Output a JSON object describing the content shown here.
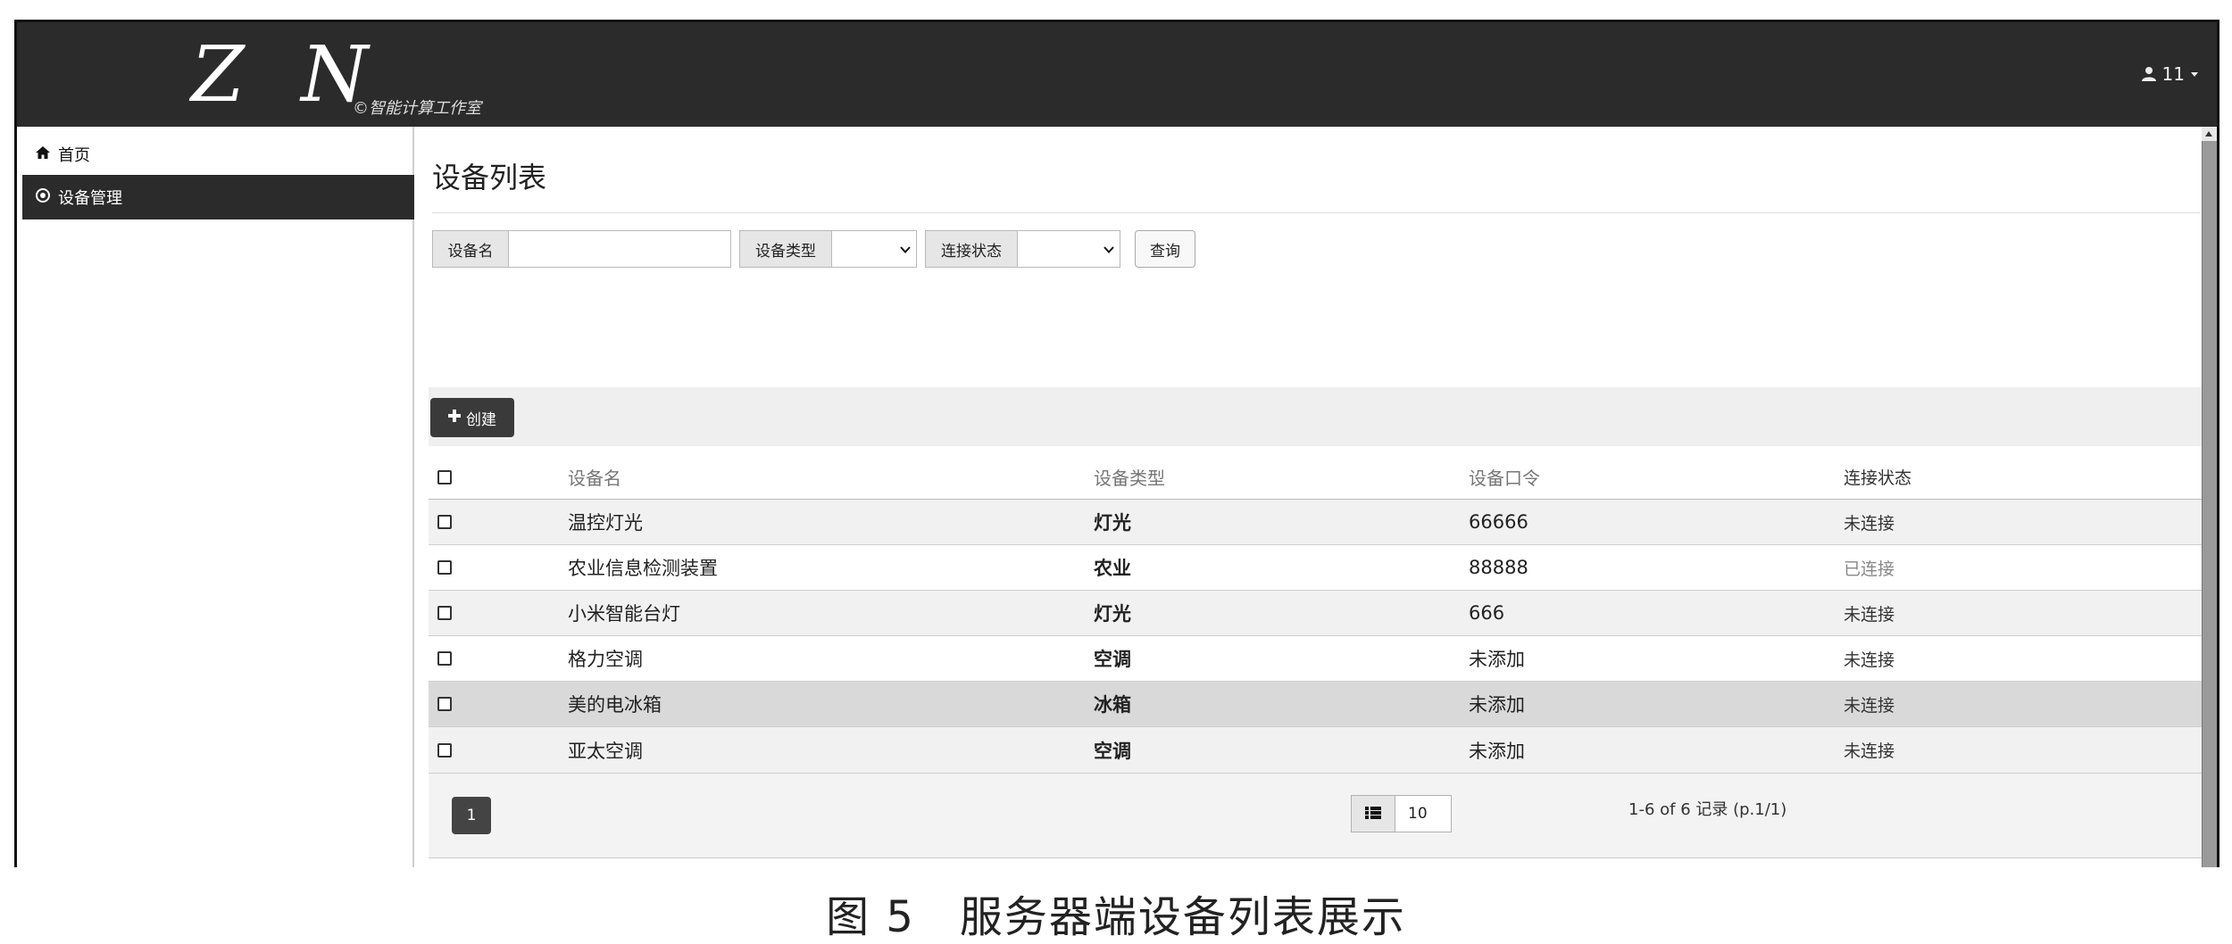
{
  "brand": {
    "logo": "Z N",
    "copyright": "©智能计算工作室"
  },
  "user": {
    "name": "11"
  },
  "sidebar": {
    "items": [
      {
        "label": "首页",
        "icon": "home-icon",
        "active": false
      },
      {
        "label": "设备管理",
        "icon": "circle-icon",
        "active": true
      }
    ]
  },
  "page": {
    "title": "设备列表"
  },
  "filters": {
    "name_label": "设备名",
    "name_value": "",
    "type_label": "设备类型",
    "type_selected": "",
    "status_label": "连接状态",
    "status_selected": "",
    "query_label": "查询"
  },
  "toolbar": {
    "create_label": "创建"
  },
  "table": {
    "columns": [
      "设备名",
      "设备类型",
      "设备口令",
      "连接状态"
    ],
    "rows": [
      {
        "name": "温控灯光",
        "type": "灯光",
        "code": "66666",
        "status": "未连接"
      },
      {
        "name": "农业信息检测装置",
        "type": "农业",
        "code": "88888",
        "status": "已连接"
      },
      {
        "name": "小米智能台灯",
        "type": "灯光",
        "code": "666",
        "status": "未连接"
      },
      {
        "name": "格力空调",
        "type": "空调",
        "code": "未添加",
        "status": "未连接"
      },
      {
        "name": "美的电冰箱",
        "type": "冰箱",
        "code": "未添加",
        "status": "未连接"
      },
      {
        "name": "亚太空调",
        "type": "空调",
        "code": "未添加",
        "status": "未连接"
      }
    ]
  },
  "pagination": {
    "current_page": "1",
    "page_size": "10",
    "record_info": "1-6 of 6 记录 (p.1/1)"
  },
  "caption": "图 5　服务器端设备列表展示"
}
